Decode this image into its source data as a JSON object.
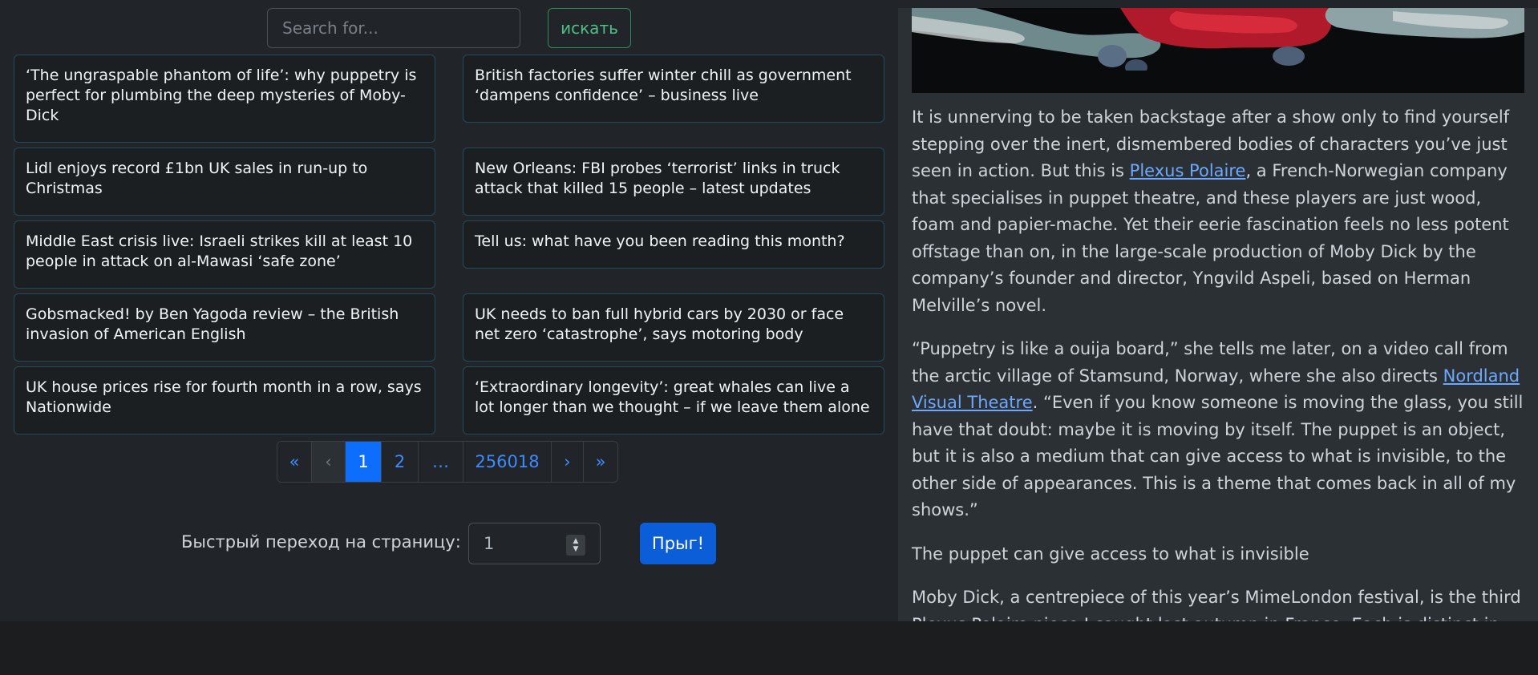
{
  "search": {
    "placeholder": "Search for...",
    "button_label": "искать"
  },
  "news": [
    "‘The ungraspable phantom of life’: why puppetry is perfect for plumbing the deep mysteries of Moby-Dick",
    "British factories suffer winter chill as government ‘dampens confidence’ – business live",
    "Lidl enjoys record £1bn UK sales in run-up to Christmas",
    "New Orleans: FBI probes ‘terrorist’ links in truck attack that killed 15 people – latest updates",
    "Middle East crisis live: Israeli strikes kill at least 10 people in attack on al-Mawasi ‘safe zone’",
    "Tell us: what have you been reading this month?",
    "Gobsmacked! by Ben Yagoda review – the British invasion of American English",
    "UK needs to ban full hybrid cars by 2030 or face net zero ‘catastrophe’, says motoring body",
    "UK house prices rise for fourth month in a row, says Nationwide",
    "‘Extraordinary longevity’: great whales can live a lot longer than we thought – if we leave them alone"
  ],
  "pagination": {
    "first": "«",
    "prev": "‹",
    "current": "1",
    "page2": "2",
    "ellipsis": "…",
    "last_page": "256018",
    "next": "›",
    "last": "»"
  },
  "quick_jump": {
    "label": "Быстрый переход на страницу:",
    "value": "1",
    "button_label": "Прыг!"
  },
  "article": {
    "p1_a": "It is unnerving to be taken backstage after a show only to find yourself stepping over the inert, dismembered bodies of characters you’ve just seen in action. But this is ",
    "p1_link": "Plexus Polaire",
    "p1_b": ", a French-Norwegian company that specialises in puppet theatre, and these players are just wood, foam and papier-mache. Yet their eerie fascination feels no less potent offstage than on, in the large-scale production of Moby Dick by the company’s founder and director, Yngvild Aspeli, based on Herman Melville’s novel.",
    "p2_a": "“Puppetry is like a ouija board,” she tells me later, on a video call from the arctic village of Stamsund, Norway, where she also directs ",
    "p2_link": "Nordland Visual Theatre",
    "p2_b": ". “Even if you know someone is moving the glass, you still have that doubt: maybe it is moving by itself. The puppet is an object, but it is also a medium that can give access to what is invisible, to the other side of appearances. This is a theme that comes back in all of my shows.”",
    "p3": "The puppet can give access to what is invisible",
    "p4": "Moby Dick, a centrepiece of this year’s MimeLondon festival, is the third Plexus Polaire piece I caught last autumn in France. Each is distinct in scale and subject, but all mix live actors with puppets, and share a profound sense of the inexplicable..."
  },
  "colors": {
    "accent": "#0d6efd",
    "link": "#6ea8fe",
    "success": "#4fbf86"
  }
}
